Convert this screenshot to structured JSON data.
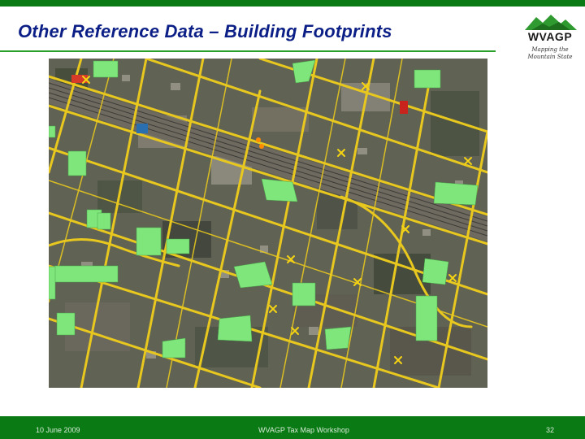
{
  "slide": {
    "title": "Other Reference Data – Building Footprints",
    "logo_text": "WVAGP",
    "tagline_line1": "Mapping the",
    "tagline_line2": "Mountain State"
  },
  "footer": {
    "date": "10 June 2009",
    "event": "WVAGP Tax Map Workshop",
    "page_number": "32"
  },
  "colors": {
    "accent_green": "#0a7a14",
    "title_blue": "#0c1f86",
    "road_yellow": "#e8c81e",
    "footprint_green": "#7ee67a",
    "marker_yellow": "#f5d313"
  }
}
